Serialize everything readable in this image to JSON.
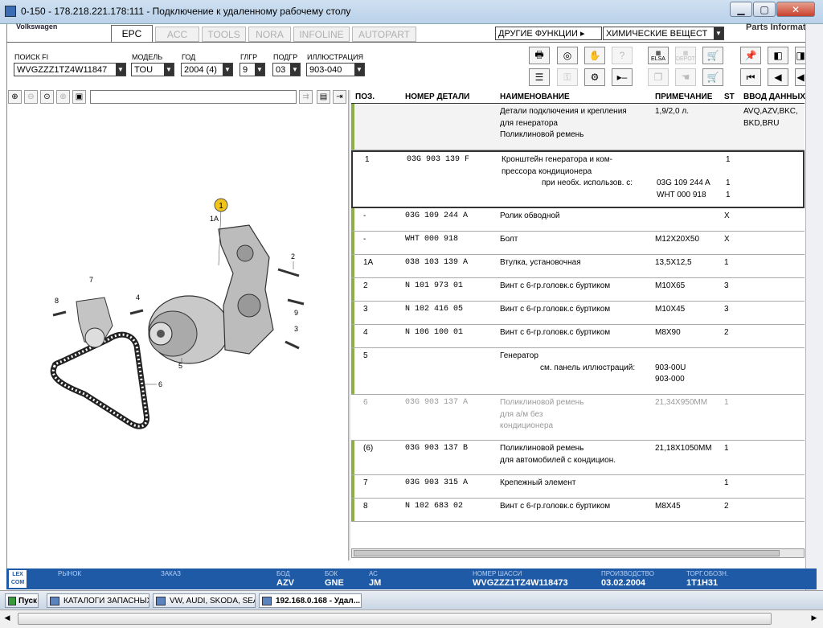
{
  "window": {
    "title": "0-150 - 178.218.221.178:111 - Подключение к удаленному рабочему столу"
  },
  "brand": {
    "left": "Volkswagen",
    "right": "Parts Informat"
  },
  "tabs": [
    "EPC",
    "ACC",
    "TOOLS",
    "NORA",
    "INFOLINE",
    "AUTOPART"
  ],
  "menus": {
    "other_functions": "ДРУГИЕ ФУНКЦИИ ▸",
    "chemicals": "ХИМИЧЕСКИЕ ВЕЩЕСТ"
  },
  "filters": {
    "search_label": "ПОИСК FI",
    "search_value": "WVGZZZ1TZ4W11847",
    "model_label": "МОДЕЛЬ",
    "model_value": "TOU",
    "year_label": "ГОД",
    "year_value": "2004 (4)",
    "group_label": "ГЛГР",
    "group_value": "9",
    "subgroup_label": "ПОДГР",
    "subgroup_value": "03",
    "illustration_label": "ИЛЛЮСТРАЦИЯ",
    "illustration_value": "903-040"
  },
  "toolbar": {
    "elsa": "ELSA",
    "depot": "DEPOT"
  },
  "table": {
    "headers": {
      "pos": "ПОЗ.",
      "part": "НОМЕР ДЕТАЛИ",
      "name": "НАИМЕНОВАНИЕ",
      "note": "ПРИМЕЧАНИЕ",
      "st": "ST",
      "data": "ВВОД ДАННЫХ"
    },
    "rows": [
      {
        "pos": "",
        "part": "",
        "name": [
          "Детали подключения и крепления",
          "для генератора",
          "Поликлиновой ремень"
        ],
        "note": [
          "1,9/2,0 л."
        ],
        "st": [],
        "data": [
          "AVQ,AZV,BKC,",
          "BKD,BRU"
        ]
      },
      {
        "pos": "1",
        "part": "03G  903  139  F",
        "name": [
          "Кронштейн генератора и ком-",
          "прессора кондиционера",
          "при необх. использов. с:"
        ],
        "note": [
          "",
          "",
          "03G 109 244 A",
          "WHT 000 918"
        ],
        "st": [
          "1",
          "",
          "1",
          "1"
        ],
        "data": []
      },
      {
        "pos": "-",
        "part": "03G  109  244  A",
        "name": [
          "Ролик обводной"
        ],
        "note": [],
        "st": [
          "X"
        ],
        "data": []
      },
      {
        "pos": "-",
        "part": "WHT  000  918",
        "name": [
          "Болт"
        ],
        "note": [
          "M12X20X50"
        ],
        "st": [
          "X"
        ],
        "data": []
      },
      {
        "pos": "1A",
        "part": "038  103  139  A",
        "name": [
          "Втулка, установочная"
        ],
        "note": [
          "13,5X12,5"
        ],
        "st": [
          "1"
        ],
        "data": []
      },
      {
        "pos": "2",
        "part": "N    101  973  01",
        "name": [
          "Винт с 6-гр.головк.с буртиком"
        ],
        "note": [
          "M10X65"
        ],
        "st": [
          "3"
        ],
        "data": []
      },
      {
        "pos": "3",
        "part": "N    102  416  05",
        "name": [
          "Винт с 6-гр.головк.с буртиком"
        ],
        "note": [
          "M10X45"
        ],
        "st": [
          "3"
        ],
        "data": []
      },
      {
        "pos": "4",
        "part": "N    106  100  01",
        "name": [
          "Винт с 6-гр.головк.с буртиком"
        ],
        "note": [
          "M8X90"
        ],
        "st": [
          "2"
        ],
        "data": []
      },
      {
        "pos": "5",
        "part": "",
        "name": [
          "Генератор",
          "см. панель иллюстраций:"
        ],
        "note": [
          "",
          "903-00U",
          "903-000"
        ],
        "st": [],
        "data": []
      },
      {
        "pos": "6",
        "part": "03G  903  137  A",
        "name": [
          "Поликлиновой ремень",
          "для а/м без",
          "кондиционера"
        ],
        "note": [
          "21,34X950MM"
        ],
        "st": [
          "1"
        ],
        "data": []
      },
      {
        "pos": "(6)",
        "part": "03G  903  137  B",
        "name": [
          "Поликлиновой ремень",
          "для автомобилей с кондицион."
        ],
        "note": [
          "21,18X1050MM"
        ],
        "st": [
          "1"
        ],
        "data": []
      },
      {
        "pos": "7",
        "part": "03G  903  315  A",
        "name": [
          "Крепежный элемент"
        ],
        "note": [],
        "st": [
          "1"
        ],
        "data": []
      },
      {
        "pos": "8",
        "part": "N    102  683  02",
        "name": [
          "Винт с 6-гр.головк.с буртиком"
        ],
        "note": [
          "M8X45"
        ],
        "st": [
          "2"
        ],
        "data": []
      }
    ]
  },
  "diagram": {
    "callouts": [
      "1",
      "1A",
      "2",
      "3",
      "4",
      "5",
      "6",
      "7",
      "8",
      "9"
    ]
  },
  "status": {
    "market_label": "РЫНОК",
    "market_value": "",
    "order_label": "ЗАКАЗ",
    "order_value": "",
    "body_label": "БОД",
    "body_value": "AZV",
    "gearbox_label": "БОК",
    "gearbox_value": "GNE",
    "ac_label": "АС",
    "ac_value": "JM",
    "chassis_label": "НОМЕР ШАССИ",
    "chassis_value": "WVGZZZ1TZ4W118473",
    "production_label": "ПРОИЗВОДСТВО",
    "production_value": "03.02.2004",
    "trade_label": "ТОРГ.ОБОЗН.",
    "trade_value": "1T1H31",
    "lexcom": [
      "LEX",
      "COM"
    ]
  },
  "taskbar": {
    "start": "Пуск",
    "items": [
      "КАТАЛОГИ ЗАПАСНЫХ ...",
      "VW, AUDI, SKODA, SEAT",
      "192.168.0.168 - Удал..."
    ]
  }
}
